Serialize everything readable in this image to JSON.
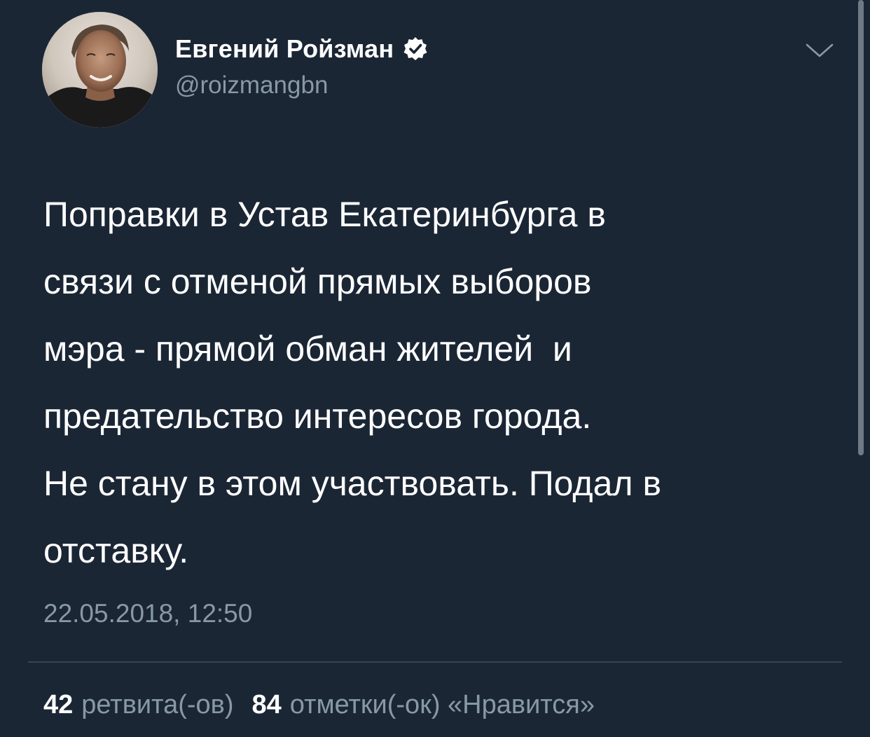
{
  "author": {
    "name": "Евгений Ройзман",
    "handle": "@roizmangbn",
    "verified": true
  },
  "tweet": {
    "text": "Поправки в Устав Екатеринбурга в\nсвязи с отменой прямых выборов\nмэра - прямой обман жителей  и\nпредательство интересов города.\nНе стану в этом участвовать. Подал в\nотставку.",
    "timestamp": "22.05.2018, 12:50"
  },
  "stats": {
    "retweets_count": "42",
    "retweets_label": "ретвита(-ов)",
    "likes_count": "84",
    "likes_label": "отметки(-ок) «Нравится»"
  },
  "icons": {
    "verified": "verified-badge-icon",
    "menu": "chevron-down-icon"
  },
  "colors": {
    "background": "#1b2635",
    "primary_text": "#ffffff",
    "secondary_text": "#8899a6",
    "divider": "#38444d"
  }
}
